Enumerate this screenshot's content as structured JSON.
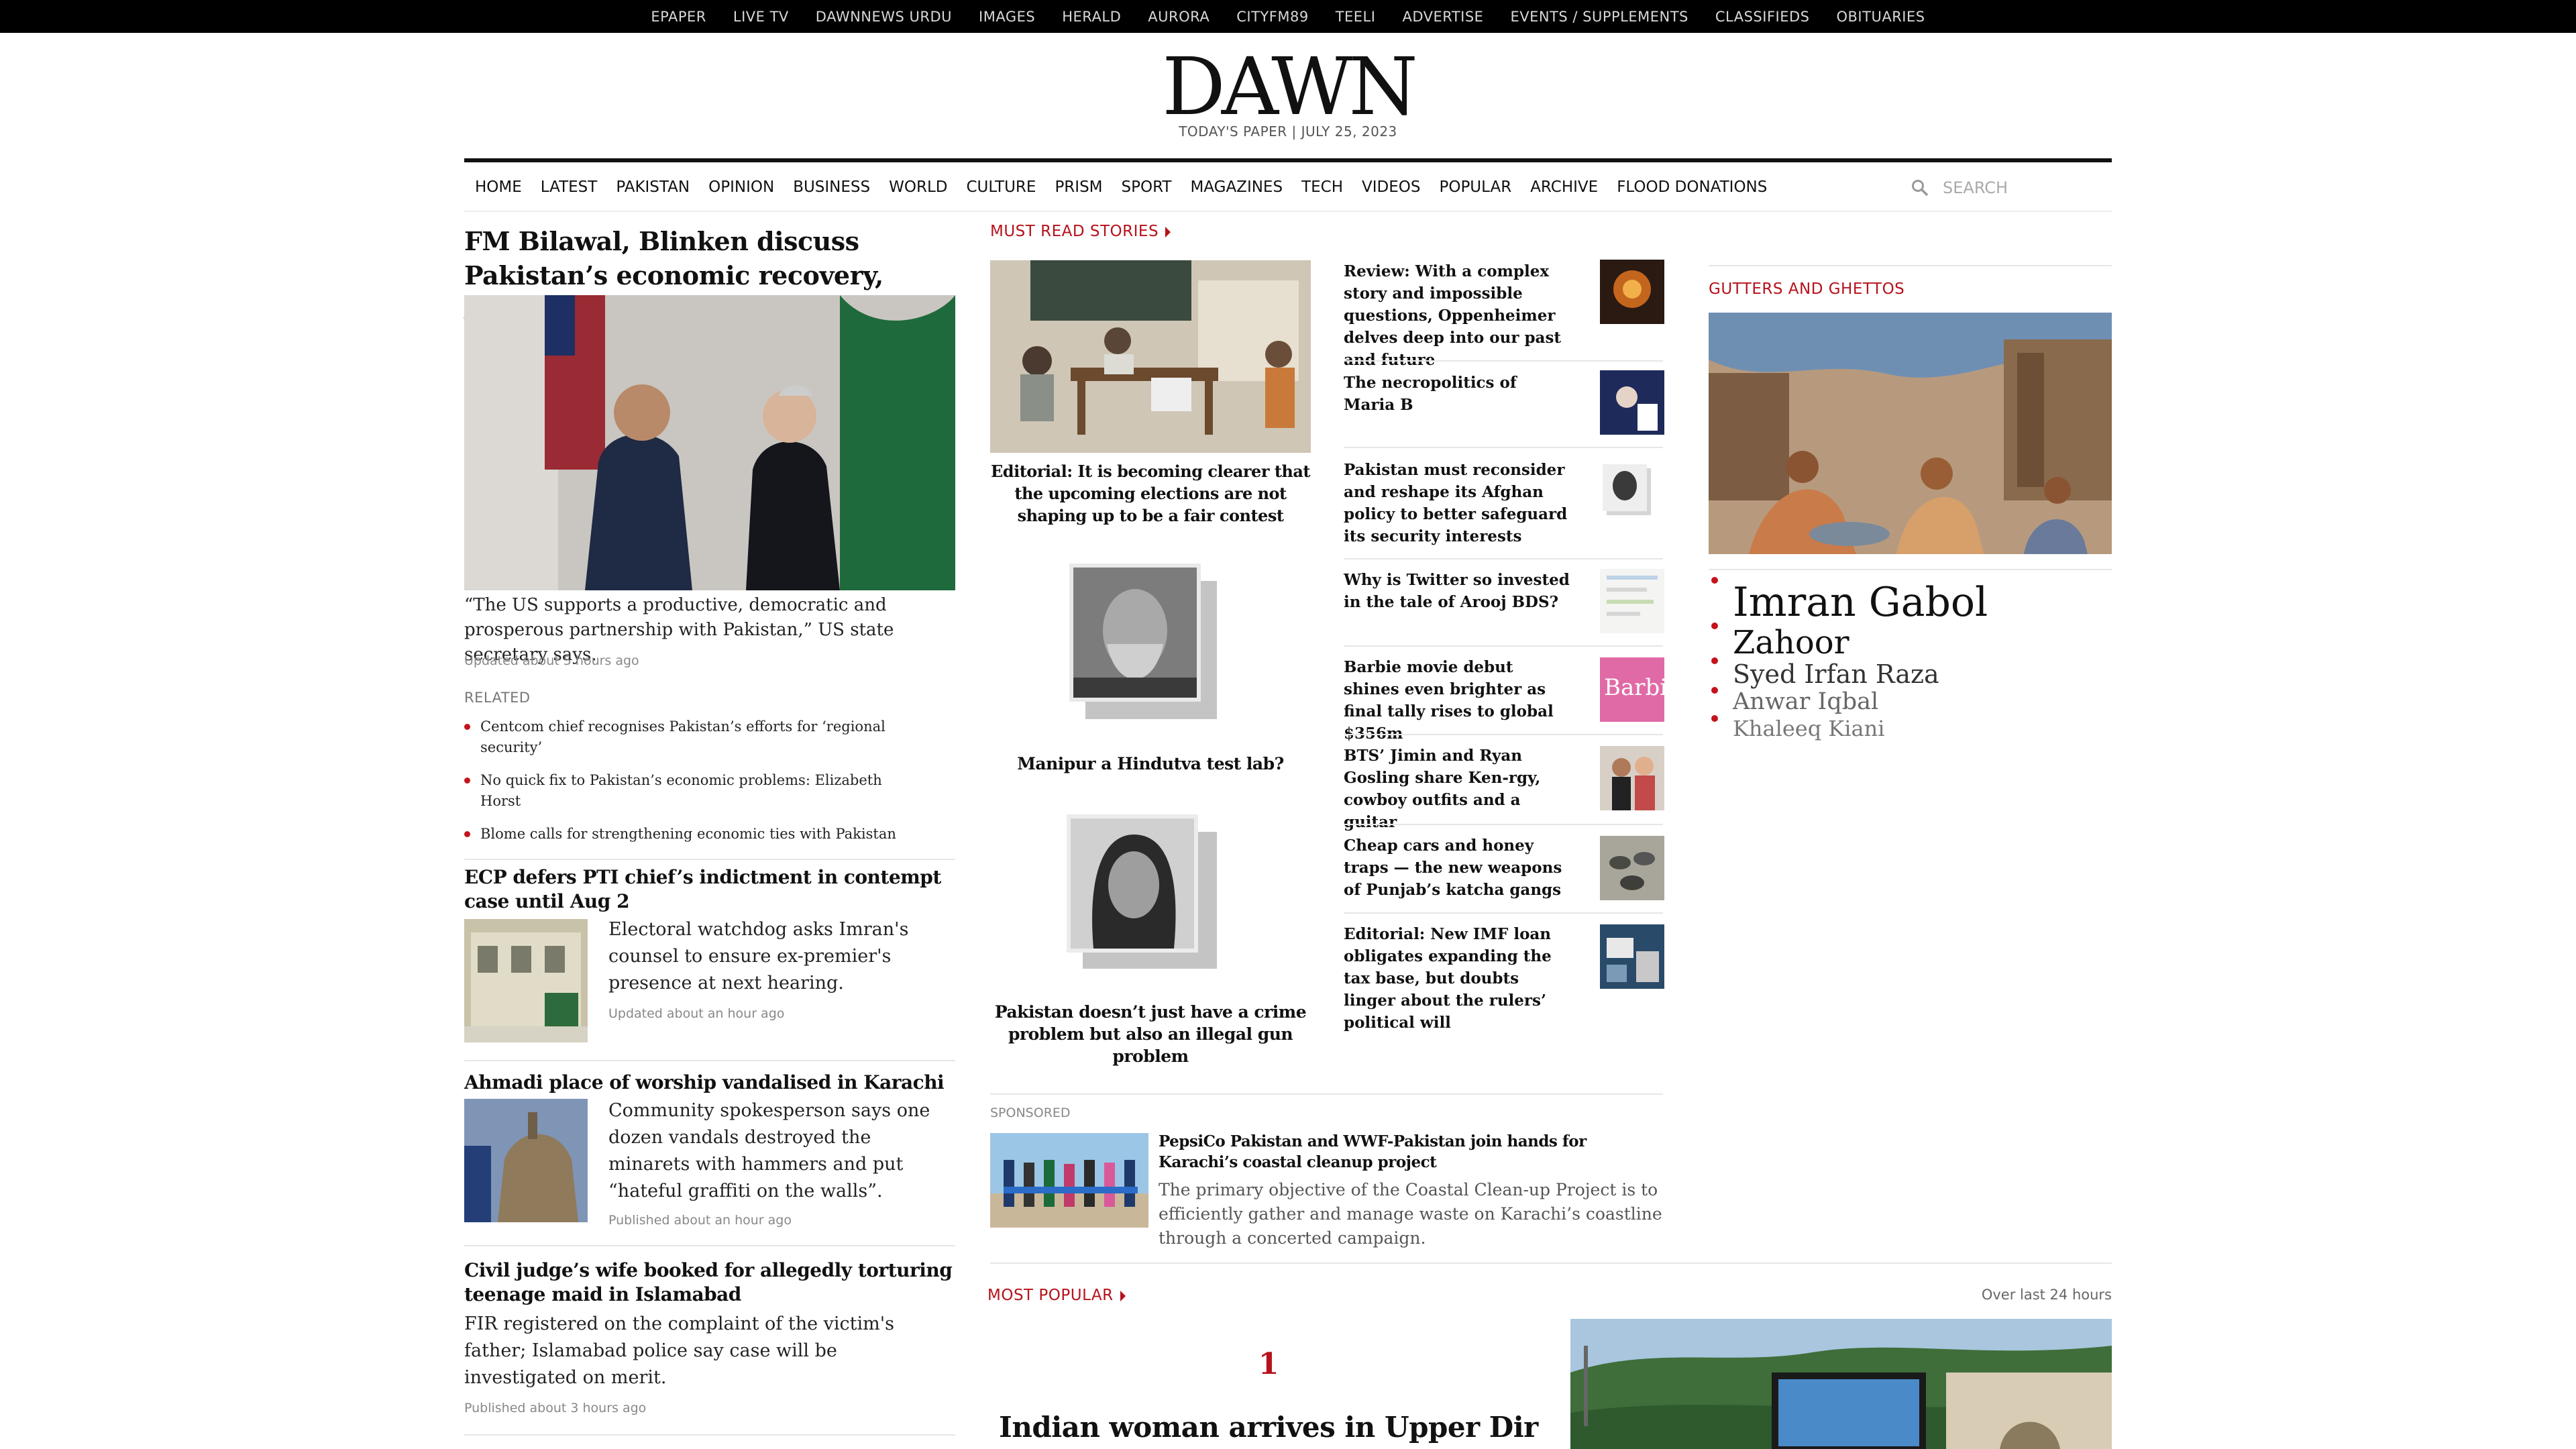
{
  "topbar": [
    "EPAPER",
    "LIVE TV",
    "DAWNNEWS URDU",
    "IMAGES",
    "HERALD",
    "AURORA",
    "CITYFM89",
    "TEELI",
    "ADVERTISE",
    "EVENTS / SUPPLEMENTS",
    "CLASSIFIEDS",
    "OBITUARIES"
  ],
  "logo": "DAWN",
  "todays_paper": "TODAY'S PAPER | JULY 25, 2023",
  "nav": [
    "HOME",
    "LATEST",
    "PAKISTAN",
    "OPINION",
    "BUSINESS",
    "WORLD",
    "CULTURE",
    "PRISM",
    "SPORT",
    "MAGAZINES",
    "TECH",
    "VIDEOS",
    "POPULAR",
    "ARCHIVE",
    "FLOOD DONATIONS"
  ],
  "search": {
    "placeholder": "SEARCH",
    "icon": "search-icon"
  },
  "lead": {
    "headline": "FM Bilawal, Blinken discuss Pakistan’s economic recovery, Afghanistan",
    "excerpt": "“The US supports a productive, democratic and prosperous partnership with Pakistan,” US state secretary says.",
    "meta": "Updated about 5 hours ago",
    "related_label": "RELATED",
    "related": [
      "Centcom chief recognises Pakistan’s efforts for ‘regional security’",
      "No quick fix to Pakistan’s economic problems: Elizabeth Horst",
      "Blome calls for strengthening economic ties with Pakistan"
    ]
  },
  "stories": [
    {
      "headline": "ECP defers PTI chief’s indictment in contempt case until Aug 2",
      "excerpt": "Electoral watchdog asks Imran's counsel to ensure ex-premier's presence at next hearing.",
      "meta": "Updated about an hour ago"
    },
    {
      "headline": "Ahmadi place of worship vandalised in Karachi",
      "excerpt": "Community spokesperson says one dozen vandals destroyed the minarets with hammers and put “hateful graffiti on the walls”.",
      "meta": "Published about an hour ago"
    },
    {
      "headline": "Civil judge’s wife booked for allegedly torturing teenage maid in Islamabad",
      "excerpt": "FIR registered on the complaint of the victim's father; Islamabad police say case will be investigated on merit.",
      "meta": "Published about 3 hours ago"
    }
  ],
  "must_read": {
    "label": "MUST READ STORIES",
    "featured": [
      "Editorial: It is becoming clearer that the upcoming elections are not shaping up to be a fair contest",
      "Manipur a Hindutva test lab?",
      "Pakistan doesn’t just have a crime problem but also an illegal gun problem"
    ],
    "side": [
      "Review: With a complex story and impossible questions, Oppenheimer delves deep into our past and future",
      "The necropolitics of Maria B",
      "Pakistan must reconsider and reshape its Afghan policy to better safeguard its security interests",
      "Why is Twitter so invested in the tale of Arooj BDS?",
      "Barbie movie debut shines even brighter as final tally rises to global $356m",
      "BTS’ Jimin and Ryan Gosling share Ken-rgy, cowboy outfits and a guitar",
      "Cheap cars and honey traps — the new weapons of Punjab’s katcha gangs",
      "Editorial: New IMF loan obligates expanding the tax base, but doubts linger about the rulers’ political will"
    ]
  },
  "sponsored": {
    "label": "SPONSORED",
    "headline": "PepsiCo Pakistan and WWF-Pakistan join hands for Karachi’s coastal cleanup project",
    "excerpt": "The primary objective of the Coastal Clean-up Project is to efficiently gather and manage waste on Karachi’s coastline through a concerted campaign."
  },
  "gutters": {
    "label": "GUTTERS AND GHETTOS",
    "names": [
      "Imran Gabol",
      "Zahoor",
      "Syed Irfan Raza",
      "Anwar Iqbal",
      "Khaleeq Kiani"
    ]
  },
  "most_popular": {
    "label": "MOST POPULAR",
    "period": "Over last 24 hours",
    "rank": "1",
    "headline": "Indian woman arrives in Upper Dir to"
  },
  "colors": {
    "accent": "#b6121b",
    "topbar": "#000000"
  }
}
